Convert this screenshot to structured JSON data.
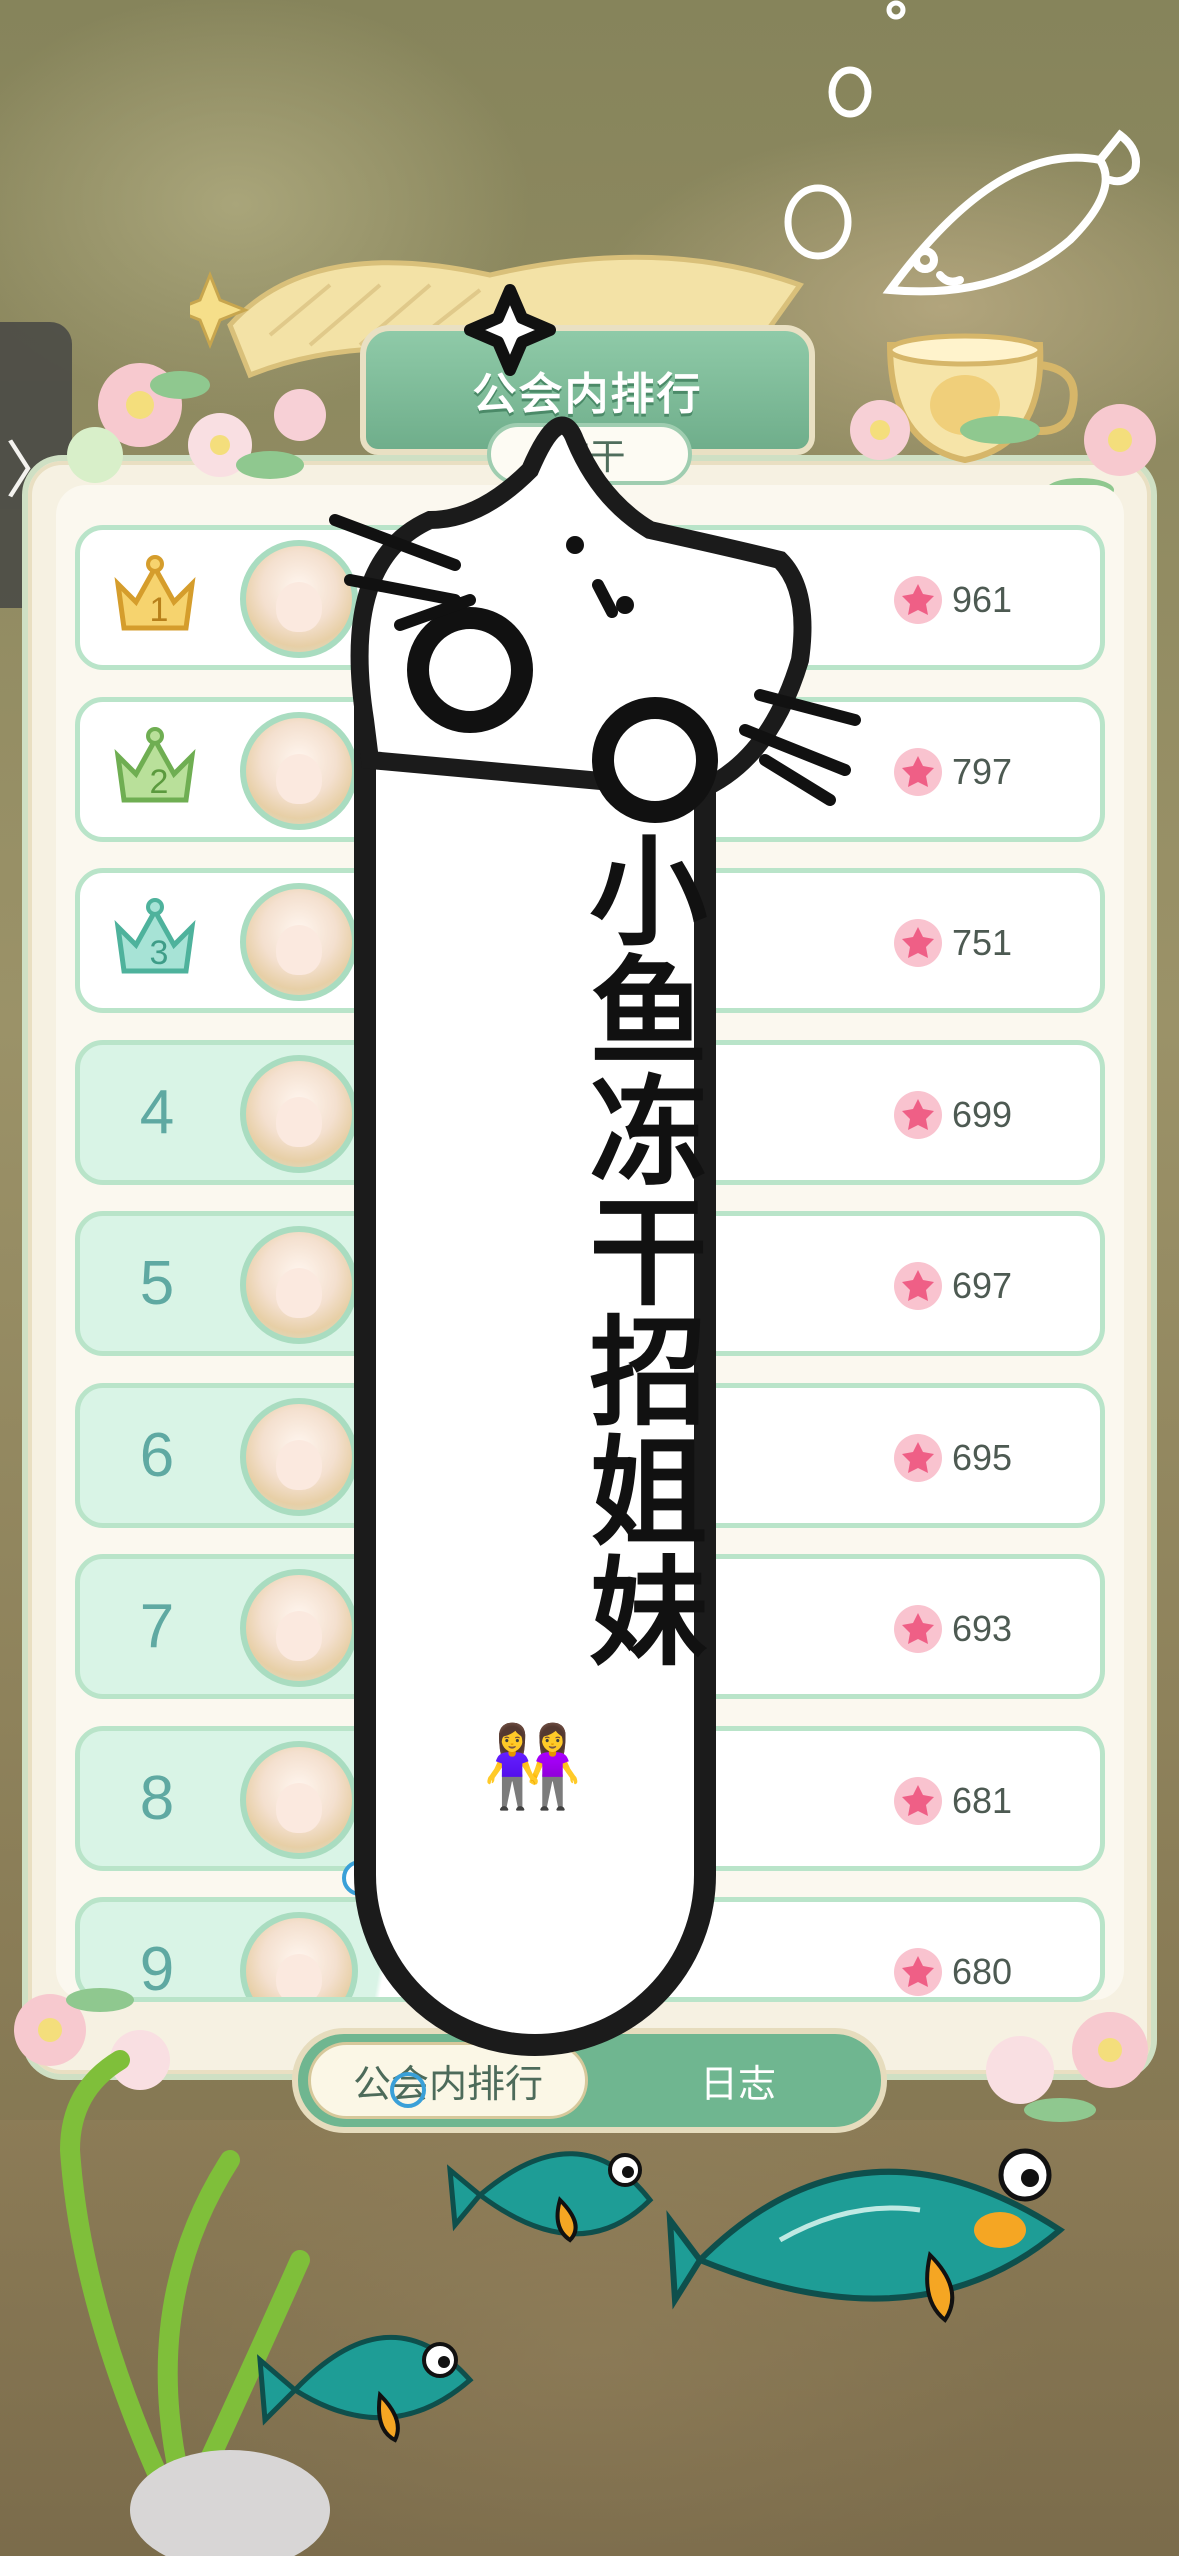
{
  "header": {
    "title": "公会内排行",
    "subtitle": "冻干"
  },
  "side_tab": {
    "icon": "chevron-right-icon",
    "glyph": "〉"
  },
  "ranking": [
    {
      "rank": "1",
      "score": "961",
      "crown": "gold"
    },
    {
      "rank": "2",
      "score": "797",
      "crown": "green"
    },
    {
      "rank": "3",
      "score": "751",
      "crown": "teal"
    },
    {
      "rank": "4",
      "score": "699"
    },
    {
      "rank": "5",
      "score": "697"
    },
    {
      "rank": "6",
      "score": "695"
    },
    {
      "rank": "7",
      "score": "693"
    },
    {
      "rank": "8",
      "score": "681"
    },
    {
      "rank": "9",
      "score": "680"
    }
  ],
  "tabs": {
    "ranking": "公会内排行",
    "log": "日志"
  },
  "sticker": {
    "text": "小鱼冻干招姐妹",
    "emoji": "👭"
  },
  "colors": {
    "accent_green": "#6fb690",
    "row_border": "#b9e4c9",
    "rank_text": "#5fa9a2",
    "score_flower": "#f26b8a"
  }
}
